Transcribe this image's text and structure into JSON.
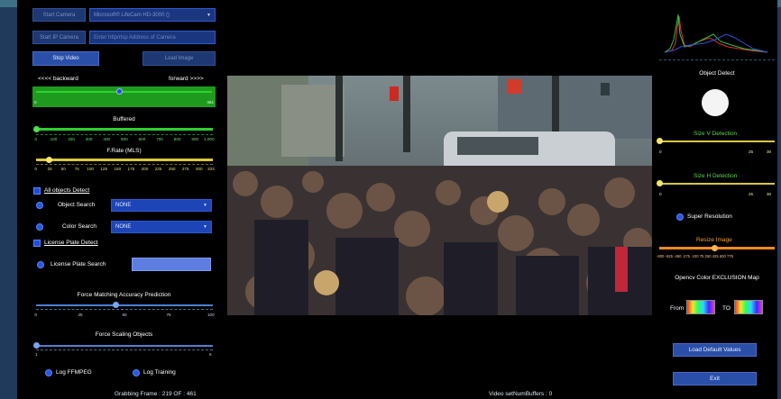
{
  "toolbar": {
    "start_camera_label": "Start Camera",
    "camera_device": "Microsoft® LifeCam HD-3000 ()",
    "start_ip_camera_label": "Start IP Camera",
    "ip_camera_placeholder": "Enter http/rtsp Address of Camera",
    "stop_video_label": "Stop Video",
    "load_image_label": "Load Image"
  },
  "navigation": {
    "backward_label": "<<<< backward",
    "forward_label": "forward >>>>",
    "position_min": "0",
    "position_max": "461",
    "position_value": 219
  },
  "buffered": {
    "title": "Buffered",
    "ticks": [
      "0",
      "100",
      "200",
      "300",
      "400",
      "500",
      "600",
      "700",
      "800",
      "900",
      "1,000"
    ]
  },
  "frame_rate": {
    "title": "F.Rate (MLS)",
    "ticks": [
      "0",
      "25",
      "50",
      "75",
      "100",
      "125",
      "150",
      "175",
      "200",
      "225",
      "250",
      "275",
      "300",
      "333"
    ],
    "value": 25
  },
  "detection": {
    "all_objects_label": "All objects Detect",
    "object_search_label": "Object Search",
    "object_search_value": "NONE",
    "color_search_label": "Color Search",
    "color_search_value": "NONE",
    "license_plate_detect_label": "License Plate Detect",
    "license_plate_search_label": "License Plate Search",
    "license_plate_value": ""
  },
  "accuracy": {
    "title": "Force Matching Accuracy Prediction",
    "ticks": [
      "0",
      "25",
      "50",
      "75",
      "100"
    ],
    "value": 45
  },
  "scaling": {
    "title": "Force Scaling Objects",
    "min": "1",
    "max": "5",
    "value": 1
  },
  "logging": {
    "ffmpeg_label": "Log FFMPEG",
    "training_label": "Log Training"
  },
  "status": {
    "grabbing_frame": "Grabbing Frame : 219 OF : 461",
    "video_buffers": "Video setNumBuffers : 0"
  },
  "right_panel": {
    "object_detect_label": "Object Detect",
    "size_v_title": "Size V Detection",
    "size_v_ticks": [
      "0",
      "25",
      "30"
    ],
    "size_h_title": "Size H Detection",
    "size_h_ticks": [
      "0",
      "25",
      "30"
    ],
    "super_resolution_label": "Super Resolution",
    "resize_image_title": "Resize Image",
    "resize_ticks": "-800 -625 -450 -275 -100 75 250 425 600 775",
    "color_exclusion_title": "Opencv Color EXCLUSION Map",
    "from_label": "From",
    "to_label": "TO",
    "load_defaults_label": "Load Default Values",
    "exit_label": "Exit"
  },
  "colors": {
    "accent_blue": "#2a4fa8",
    "slider_green": "#3ec93a",
    "slider_yellow": "#d7c83a",
    "slider_orange": "#f08a1c",
    "slider_blue": "#4d7fd6"
  }
}
